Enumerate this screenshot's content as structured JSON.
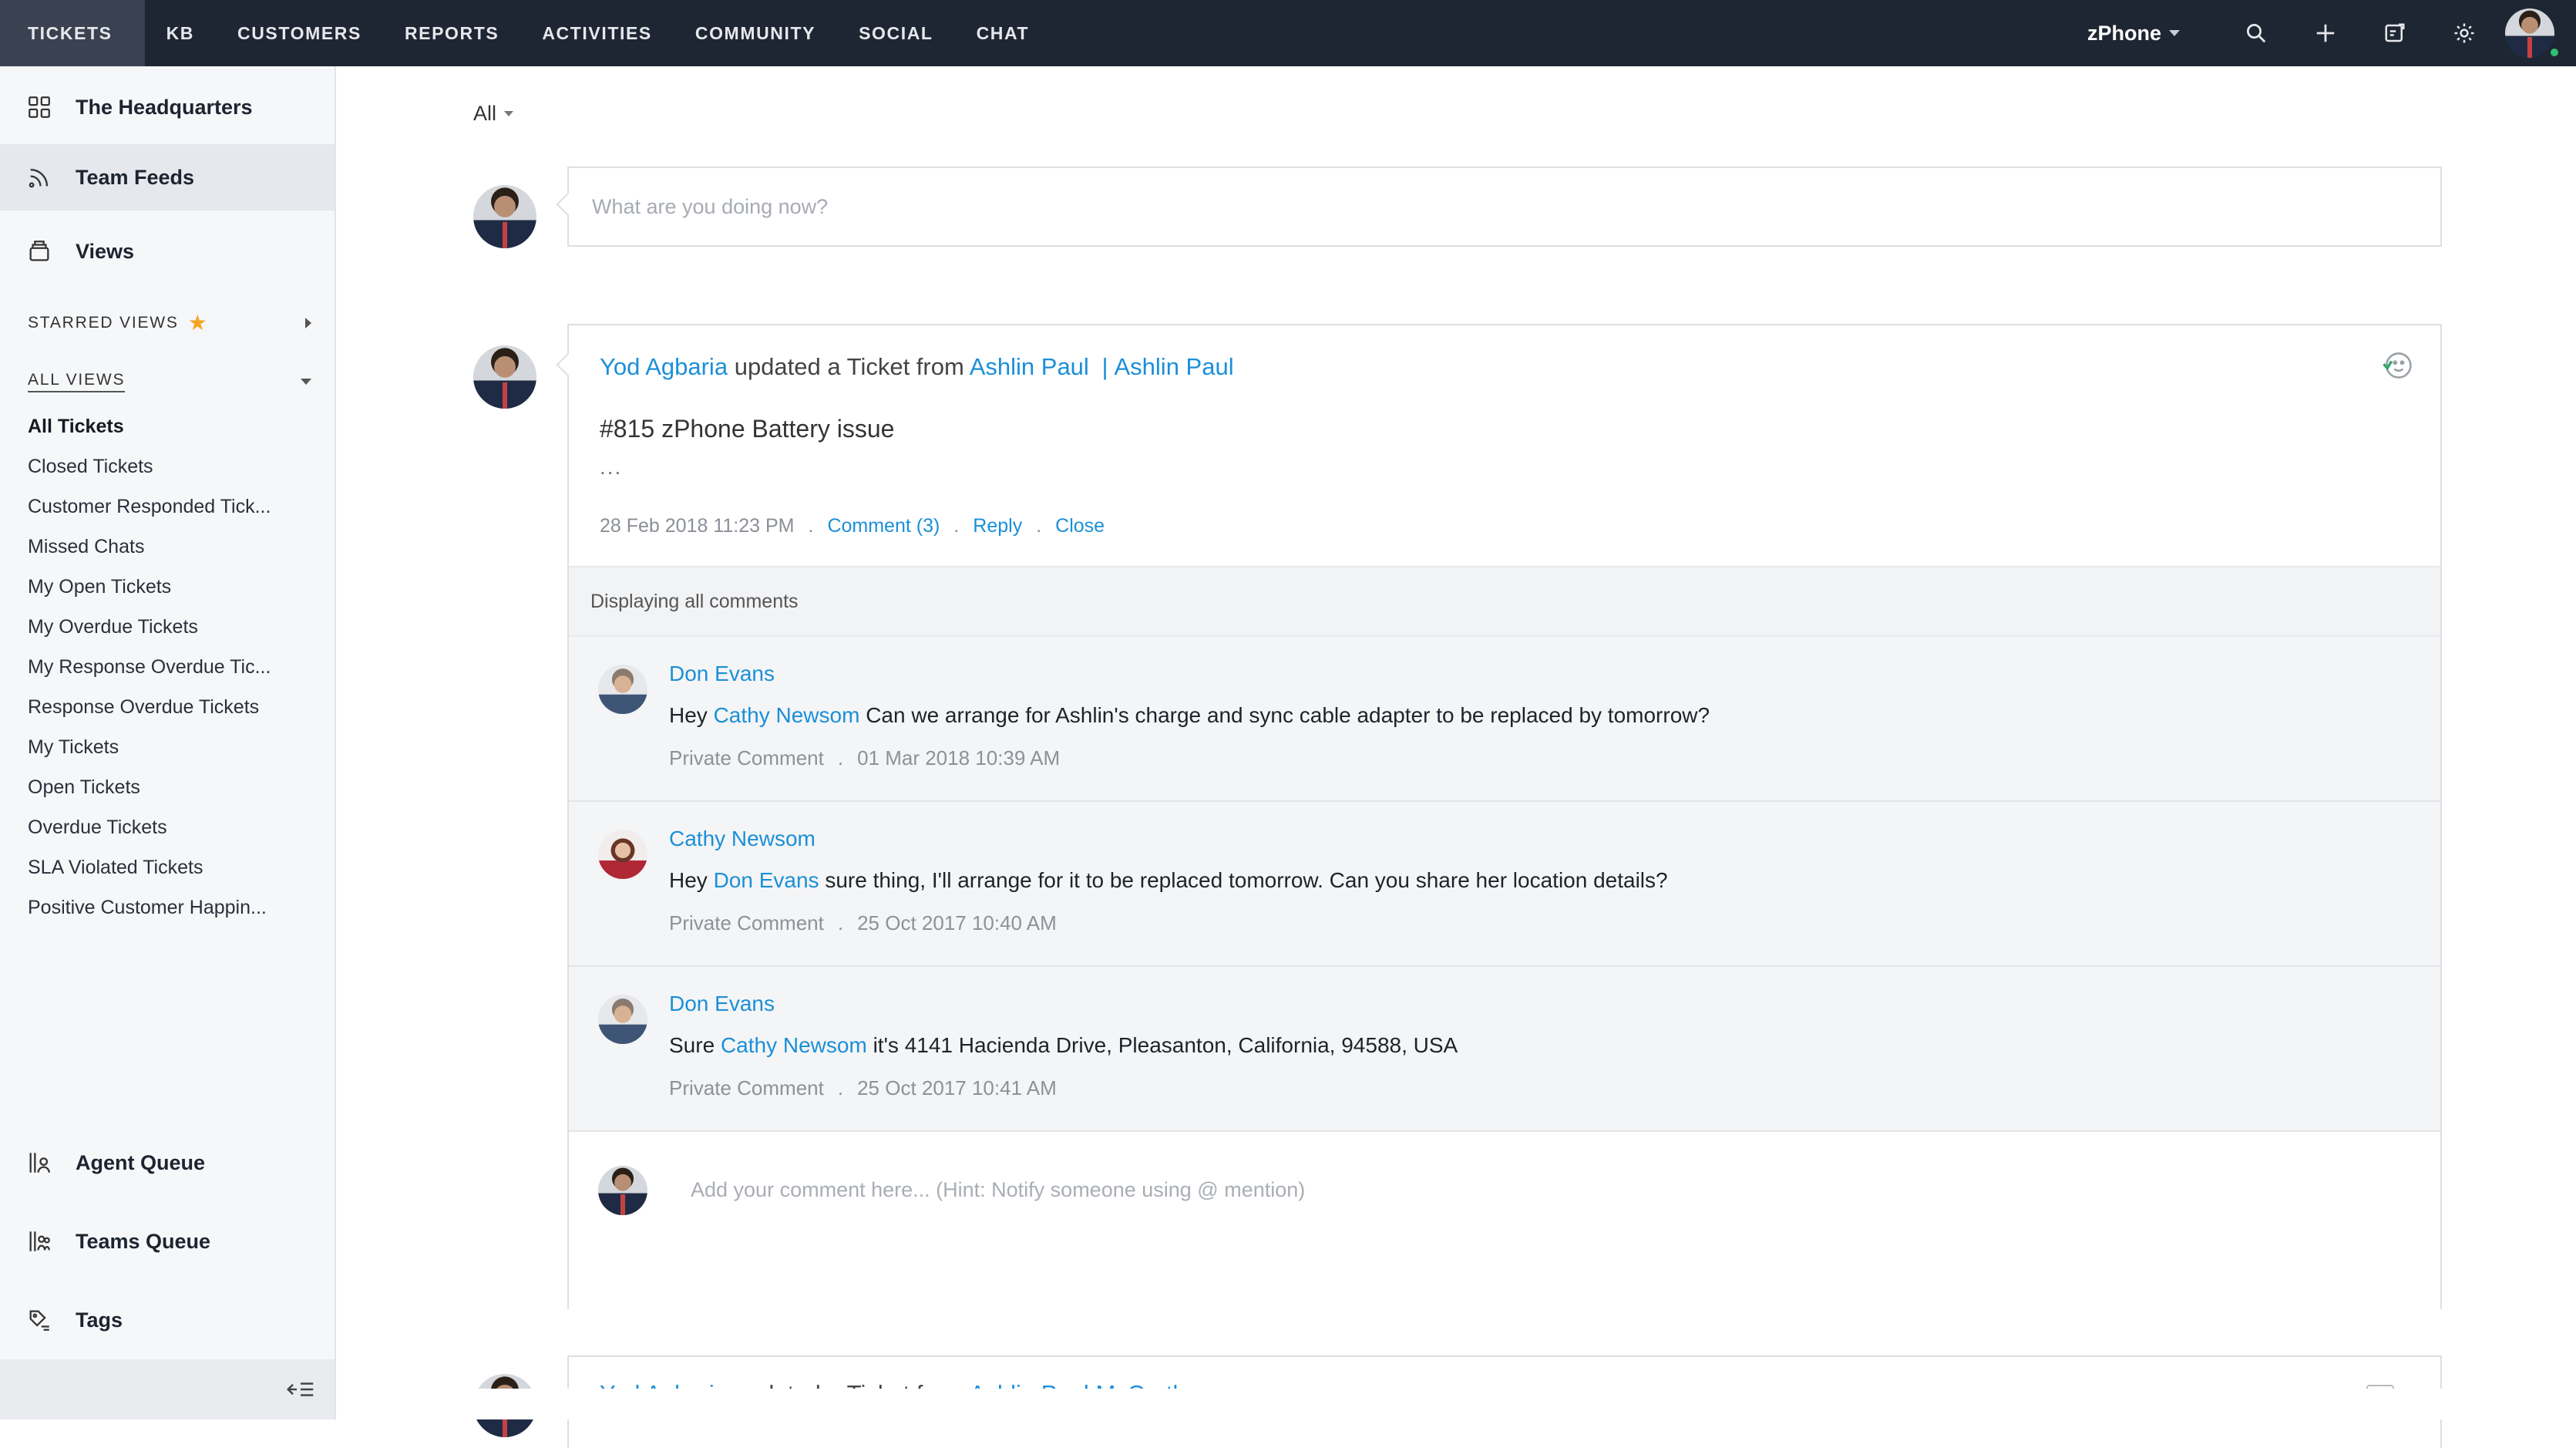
{
  "topnav": {
    "tabs": [
      "TICKETS",
      "KB",
      "CUSTOMERS",
      "REPORTS",
      "ACTIVITIES",
      "COMMUNITY",
      "SOCIAL",
      "CHAT"
    ],
    "department": "zPhone",
    "icons": [
      "search-icon",
      "plus-icon",
      "compose-icon",
      "gear-icon"
    ]
  },
  "sidebar": {
    "main_items": [
      {
        "label": "The Headquarters",
        "icon": "grid-icon"
      },
      {
        "label": "Team Feeds",
        "icon": "feed-icon"
      },
      {
        "label": "Views",
        "icon": "views-icon"
      }
    ],
    "starred_views_label": "STARRED VIEWS",
    "all_views_label": "ALL VIEWS",
    "views": [
      "All Tickets",
      "Closed Tickets",
      "Customer Responded Tick...",
      "Missed Chats",
      "My Open Tickets",
      "My Overdue Tickets",
      "My Response Overdue Tic...",
      "Response Overdue Tickets",
      "My Tickets",
      "Open Tickets",
      "Overdue Tickets",
      "SLA Violated Tickets",
      "Positive Customer Happin..."
    ],
    "bottom_items": [
      {
        "label": "Agent Queue",
        "icon": "agent-queue-icon"
      },
      {
        "label": "Teams Queue",
        "icon": "teams-queue-icon"
      },
      {
        "label": "Tags",
        "icon": "tags-icon"
      }
    ]
  },
  "main": {
    "filter": "All",
    "compose_placeholder": "What are you doing now?",
    "feed_item": {
      "actor": "Yod Agbaria",
      "action": "updated a Ticket from",
      "contact": "Ashlin Paul",
      "account": "Ashlin Paul",
      "separator": "|",
      "ticket_title": "#815 zPhone Battery issue",
      "ellipsis": "...",
      "timestamp": "28 Feb 2018 11:23 PM",
      "comment_link": "Comment (3)",
      "reply_link": "Reply",
      "close_link": "Close",
      "comments_header": "Displaying all comments",
      "comments": [
        {
          "author": "Don Evans",
          "prefix": "Hey",
          "mention": "Cathy Newsom",
          "text": "Can we arrange for Ashlin's charge and sync cable adapter to be replaced by tomorrow?",
          "type": "Private Comment",
          "time": "01 Mar 2018 10:39 AM"
        },
        {
          "author": "Cathy Newsom",
          "prefix": "Hey",
          "mention": "Don Evans",
          "text": "sure thing, I'll arrange for it to be replaced tomorrow. Can you share her location details?",
          "type": "Private Comment",
          "time": "25 Oct 2017 10:40 AM"
        },
        {
          "author": "Don Evans",
          "prefix": "Sure",
          "mention": "Cathy Newsom",
          "text": "it's 4141 Hacienda Drive, Pleasanton, California, 94588, USA",
          "type": "Private Comment",
          "time": "25 Oct 2017 10:41 AM"
        }
      ],
      "reply_placeholder": "Add your comment here... (Hint: Notify someone using @ mention)"
    },
    "next_feed_item": {
      "actor": "Yod Agbaria",
      "action": "updated a Ticket from",
      "contact": "Ashlin Paul",
      "account": "McCarthy"
    }
  },
  "colors": {
    "topbar": "#1f2633",
    "link": "#1b8fd9",
    "sidebar_bg": "#f6f7f9",
    "online": "#2fbf71",
    "star": "#f5a623"
  }
}
